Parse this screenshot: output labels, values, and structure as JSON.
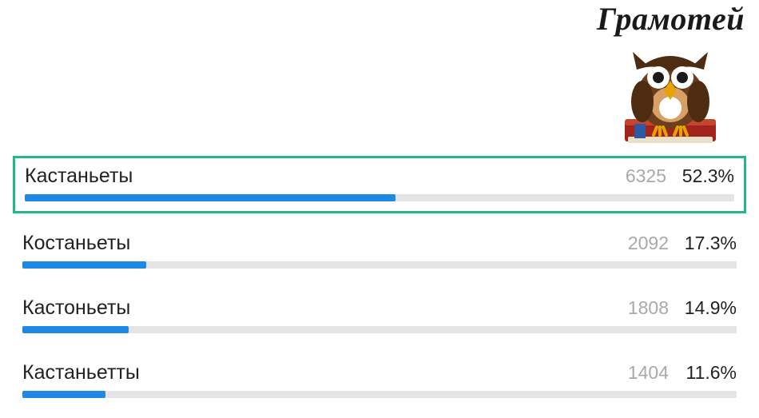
{
  "branding": {
    "title": "Грамотей"
  },
  "colors": {
    "accent": "#1e88e5",
    "correct_border": "#1fb98a",
    "track": "#e3e4e6",
    "muted": "#a9a9a9"
  },
  "chart_data": {
    "type": "bar",
    "title": "",
    "xlabel": "",
    "ylabel": "",
    "categories": [
      "Кастаньеты",
      "Костаньеты",
      "Кастоньеты",
      "Кастаньетты"
    ],
    "series": [
      {
        "name": "count",
        "values": [
          6325,
          2092,
          1808,
          1404
        ]
      },
      {
        "name": "percent",
        "values": [
          52.3,
          17.3,
          14.9,
          11.6
        ]
      }
    ]
  },
  "answers": [
    {
      "label": "Кастаньеты",
      "count": "6325",
      "percent": "52.3%",
      "bar_pct": 52.3,
      "correct": true
    },
    {
      "label": "Костаньеты",
      "count": "2092",
      "percent": "17.3%",
      "bar_pct": 17.3,
      "correct": false
    },
    {
      "label": "Кастоньеты",
      "count": "1808",
      "percent": "14.9%",
      "bar_pct": 14.9,
      "correct": false
    },
    {
      "label": "Кастаньетты",
      "count": "1404",
      "percent": "11.6%",
      "bar_pct": 11.6,
      "correct": false
    }
  ]
}
